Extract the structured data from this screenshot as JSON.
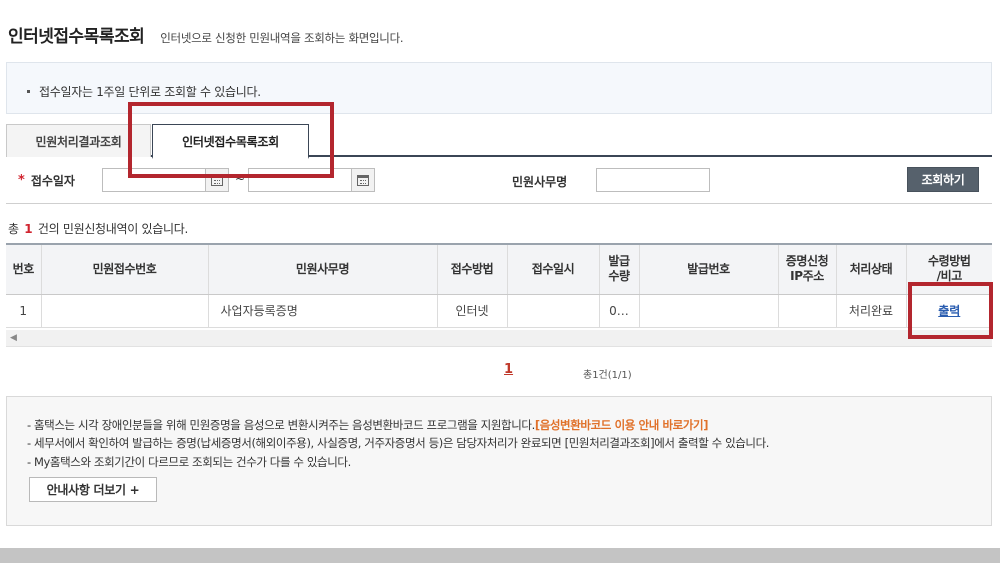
{
  "header": {
    "title": "인터넷접수목록조회",
    "description": "인터넷으로 신청한 민원내역을 조회하는 화면입니다."
  },
  "notice_top": {
    "text": "접수일자는 1주일 단위로 조회할 수 있습니다."
  },
  "tabs": [
    {
      "label": "민원처리결과조회",
      "active": false
    },
    {
      "label": "인터넷접수목록조회",
      "active": true
    }
  ],
  "search": {
    "date_label": "접수일자",
    "date_from": "",
    "date_to": "",
    "separator": "~",
    "name_label": "민원사무명",
    "name_value": "",
    "button_label": "조회하기"
  },
  "result": {
    "prefix": "총",
    "count": "1",
    "suffix": "건의 민원신청내역이 있습니다."
  },
  "table": {
    "headers": [
      "번호",
      "민원접수번호",
      "민원사무명",
      "접수방법",
      "접수일시",
      "발급\n수량",
      "발급번호",
      "증명신청\nIP주소",
      "처리상태",
      "수령방법\n/비고"
    ],
    "rows": [
      [
        "1",
        "",
        "사업자등록증명",
        "인터넷",
        "",
        "0…",
        "",
        "",
        "처리완료",
        "출력"
      ]
    ]
  },
  "pagination": {
    "current": "1",
    "total": "총1건(1/1)"
  },
  "notice_bottom": {
    "line1": "- 홈택스는 시각 장애인분들을 위해 민원증명을 음성으로 변환시켜주는 음성변환바코드 프로그램을 지원합니다.",
    "line1_link": "[음성변환바코드 이용 안내 바로가기]",
    "line2": "- 세무서에서 확인하여 발급하는 증명(납세증명서(해외이주용), 사실증명, 거주자증명서 등)은 담당자처리가 완료되면 [민원처리결과조회]에서 출력할 수 있습니다.",
    "line3": "- My홈택스와 조회기간이 다르므로 조회되는 건수가 다를 수 있습니다.",
    "more_button": "안내사항 더보기 +"
  },
  "colors": {
    "highlight": "#b3262e",
    "tab_border": "#3b4656",
    "button": "#56616c",
    "link": "#2a5db0",
    "orange": "#e0712a"
  }
}
